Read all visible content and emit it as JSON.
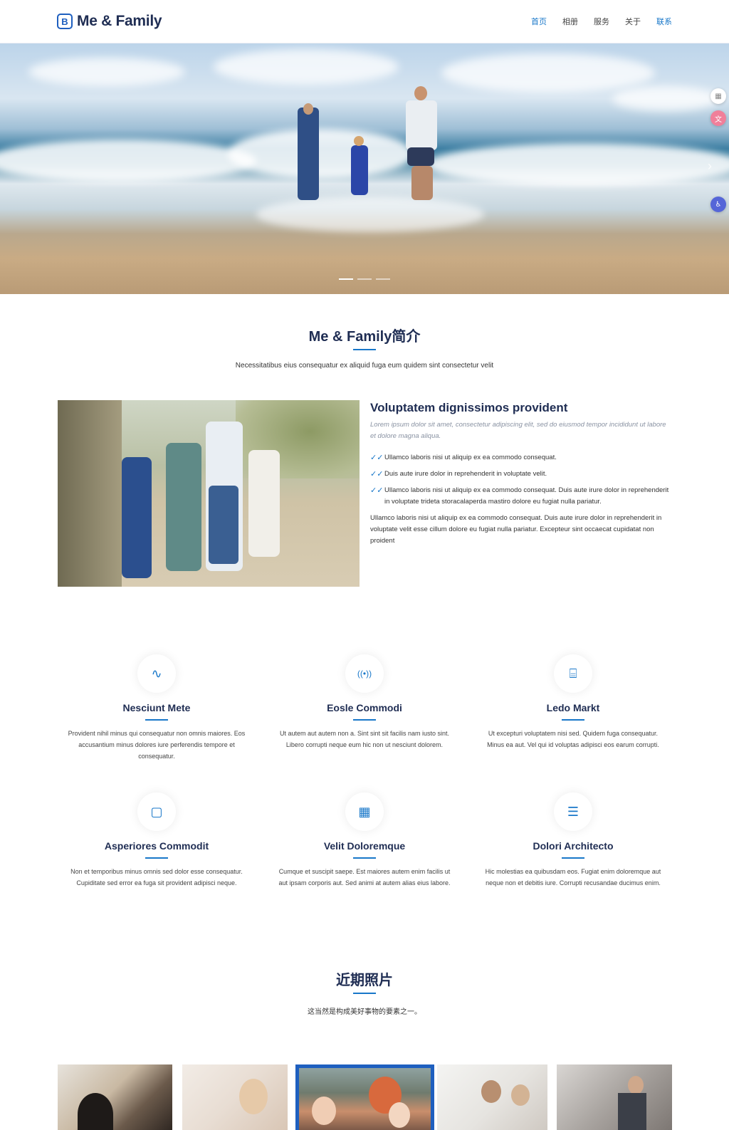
{
  "header": {
    "brand_mark": "B",
    "brand": "Me & Family",
    "nav": [
      "首页",
      "相册",
      "服务",
      "关于",
      "联系"
    ]
  },
  "hero": {
    "next_icon": "chevron-right-icon",
    "slides": 3,
    "active_slide": 1
  },
  "side_tools": [
    "grid-icon",
    "translate-icon",
    "accessibility-icon"
  ],
  "about": {
    "title": "Me & Family简介",
    "subtitle": "Necessitatibus eius consequatur ex aliquid fuga eum quidem sint consectetur velit",
    "heading": "Voluptatem dignissimos provident",
    "lead": "Lorem ipsum dolor sit amet, consectetur adipiscing elit, sed do eiusmod tempor incididunt ut labore et dolore magna aliqua.",
    "checks": [
      "Ullamco laboris nisi ut aliquip ex ea commodo consequat.",
      "Duis aute irure dolor in reprehenderit in voluptate velit.",
      "Ullamco laboris nisi ut aliquip ex ea commodo consequat. Duis aute irure dolor in reprehenderit in voluptate trideta storacalaperda mastiro dolore eu fugiat nulla pariatur."
    ],
    "paragraph": "Ullamco laboris nisi ut aliquip ex ea commodo consequat. Duis aute irure dolor in reprehenderit in voluptate velit esse cillum dolore eu fugiat nulla pariatur. Excepteur sint occaecat cupidatat non proident"
  },
  "services": [
    {
      "icon": "activity-icon",
      "glyph": "∿",
      "title": "Nesciunt Mete",
      "desc": "Provident nihil minus qui consequatur non omnis maiores. Eos accusantium minus dolores iure perferendis tempore et consequatur."
    },
    {
      "icon": "broadcast-icon",
      "glyph": "((•))",
      "title": "Eosle Commodi",
      "desc": "Ut autem aut autem non a. Sint sint sit facilis nam iusto sint. Libero corrupti neque eum hic non ut nesciunt dolorem."
    },
    {
      "icon": "easel-icon",
      "glyph": "⌸",
      "title": "Ledo Markt",
      "desc": "Ut excepturi voluptatem nisi sed. Quidem fuga consequatur. Minus ea aut. Vel qui id voluptas adipisci eos earum corrupti."
    },
    {
      "icon": "bounding-box-icon",
      "glyph": "▢",
      "title": "Asperiores Commodit",
      "desc": "Non et temporibus minus omnis sed dolor esse consequatur. Cupiditate sed error ea fuga sit provident adipisci neque."
    },
    {
      "icon": "calendar-icon",
      "glyph": "▦",
      "title": "Velit Doloremque",
      "desc": "Cumque et suscipit saepe. Est maiores autem enim facilis ut aut ipsam corporis aut. Sed animi at autem alias eius labore."
    },
    {
      "icon": "chat-square-text-icon",
      "glyph": "☰",
      "title": "Dolori Architecto",
      "desc": "Hic molestias ea quibusdam eos. Fugiat enim doloremque aut neque non et debitis iure. Corrupti recusandae ducimus enim."
    }
  ],
  "gallery": {
    "title": "近期照片",
    "subtitle": "这当然是构成美好事物的要素之一。",
    "active_index": 2
  }
}
